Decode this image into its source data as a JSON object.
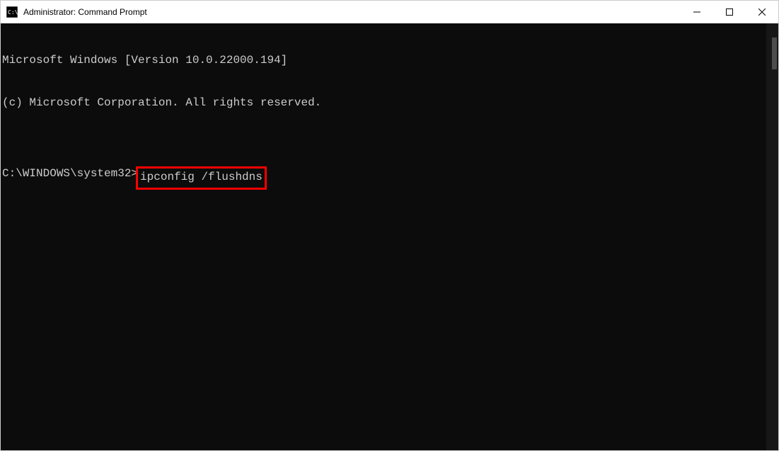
{
  "window": {
    "title": "Administrator: Command Prompt"
  },
  "terminal": {
    "line1": "Microsoft Windows [Version 10.0.22000.194]",
    "line2": "(c) Microsoft Corporation. All rights reserved.",
    "blank": "",
    "prompt": "C:\\WINDOWS\\system32>",
    "command": "ipconfig /flushdns"
  }
}
